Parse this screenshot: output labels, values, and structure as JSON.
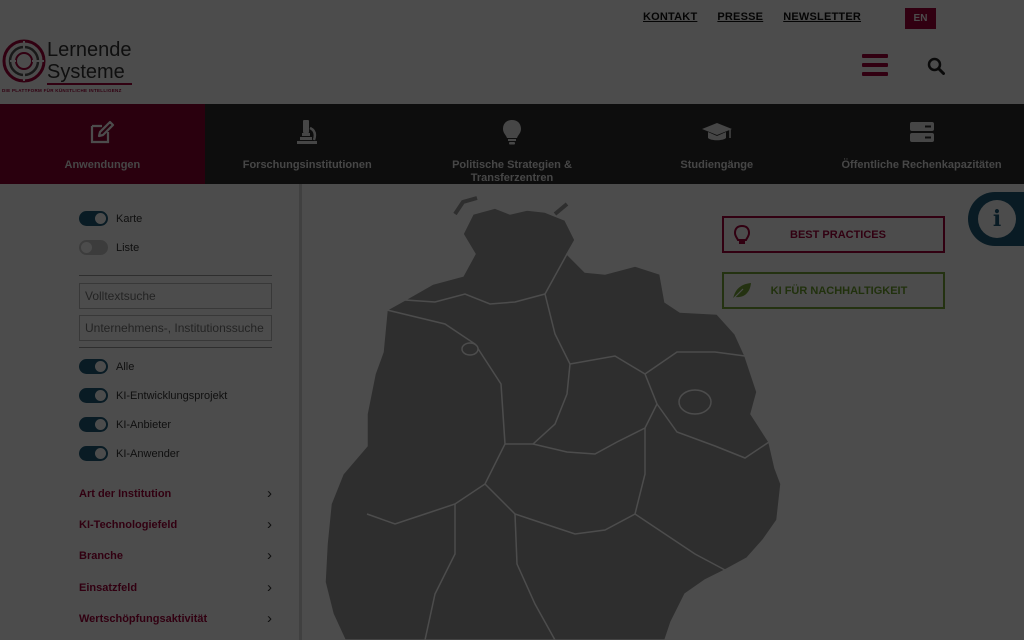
{
  "header": {
    "links": [
      {
        "label": "KONTAKT",
        "name": "kontakt-link"
      },
      {
        "label": "PRESSE",
        "name": "presse-link"
      },
      {
        "label": "NEWSLETTER",
        "name": "newsletter-link"
      }
    ],
    "lang": "EN",
    "logo_line1": "Lernende",
    "logo_line2": "Systeme",
    "logo_sub": "DIE PLATTFORM FÜR KÜNSTLICHE INTELLIGENZ",
    "menu_icon": "hamburger-icon",
    "search_icon": "search-icon"
  },
  "categories": [
    {
      "label": "Anwendungen",
      "icon": "pencil-icon",
      "active": true
    },
    {
      "label": "Forschungsinstitutionen",
      "icon": "microscope-icon",
      "active": false
    },
    {
      "label": "Politische Strategien & Transferzentren",
      "icon": "lightbulb-icon",
      "active": false
    },
    {
      "label": "Studiengänge",
      "icon": "graduation-cap-icon",
      "active": false
    },
    {
      "label": "Öffentliche Rechenkapazitäten",
      "icon": "server-icon",
      "active": false
    }
  ],
  "view": {
    "karte": {
      "label": "Karte",
      "on": true
    },
    "liste": {
      "label": "Liste",
      "on": false
    }
  },
  "search": {
    "fulltext_placeholder": "Volltextsuche",
    "institution_placeholder": "Unternehmens-, Institutionssuche"
  },
  "filters": [
    {
      "label": "Alle",
      "on": true
    },
    {
      "label": "KI-Entwicklungsprojekt",
      "on": true
    },
    {
      "label": "KI-Anbieter",
      "on": true
    },
    {
      "label": "KI-Anwender",
      "on": true
    }
  ],
  "accordions": [
    {
      "label": "Art der Institution"
    },
    {
      "label": "KI-Technologiefeld"
    },
    {
      "label": "Branche"
    },
    {
      "label": "Einsatzfeld"
    },
    {
      "label": "Wertschöpfungsaktivität"
    }
  ],
  "map_buttons": {
    "best_practices": "BEST PRACTICES",
    "ki_nachhaltigkeit": "KI FÜR NACHHALTIGKEIT",
    "info_icon": "info-icon"
  },
  "colors": {
    "brand": "#a5003a",
    "nav_bg": "#2d2d2d",
    "toggle_on": "#1f5b78",
    "green": "#7aa83a"
  }
}
